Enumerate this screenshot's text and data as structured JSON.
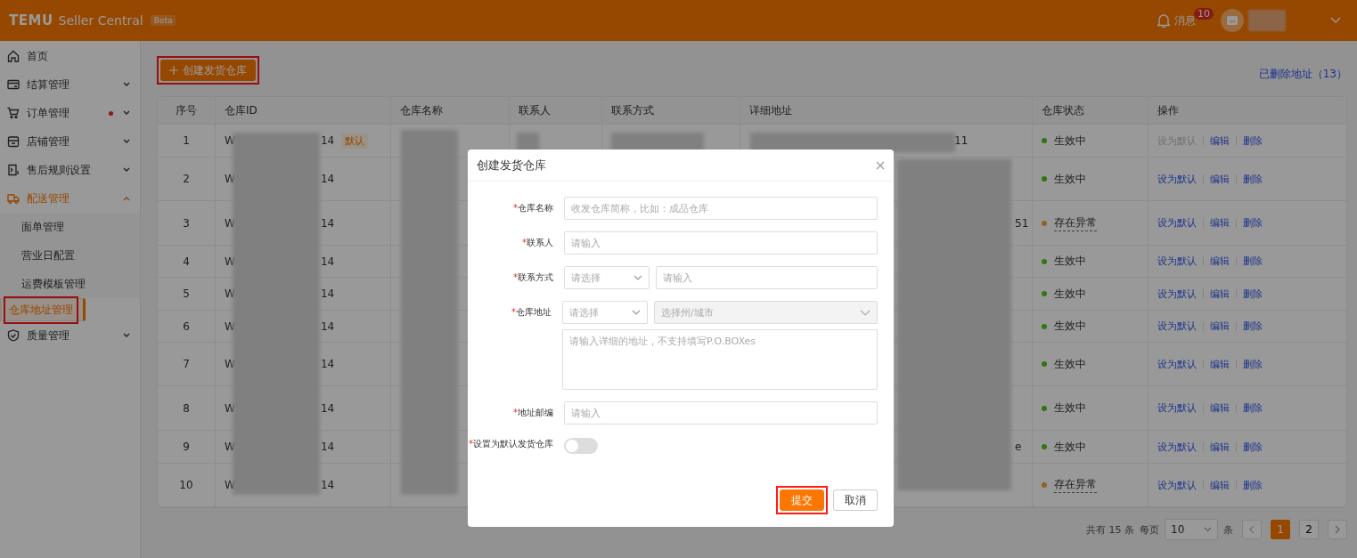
{
  "header": {
    "logo": "TEMU",
    "product": "Seller Central",
    "badge": "Beta",
    "messages": {
      "label": "消息",
      "count": "10"
    }
  },
  "sidebar": {
    "items": [
      {
        "label": "首页",
        "expandable": false,
        "expanded": false,
        "dot": false
      },
      {
        "label": "结算管理",
        "expandable": true,
        "expanded": false,
        "dot": false
      },
      {
        "label": "订单管理",
        "expandable": true,
        "expanded": false,
        "dot": true
      },
      {
        "label": "店铺管理",
        "expandable": true,
        "expanded": false,
        "dot": false
      },
      {
        "label": "售后规则设置",
        "expandable": true,
        "expanded": false,
        "dot": false
      },
      {
        "label": "配送管理",
        "expandable": true,
        "expanded": true,
        "dot": false,
        "children": [
          {
            "label": "面单管理",
            "selected": false,
            "annotated": false
          },
          {
            "label": "营业日配置",
            "selected": false,
            "annotated": false
          },
          {
            "label": "运费模板管理",
            "selected": false,
            "annotated": false
          },
          {
            "label": "仓库地址管理",
            "selected": true,
            "annotated": true
          }
        ]
      },
      {
        "label": "质量管理",
        "expandable": true,
        "expanded": false,
        "dot": false
      }
    ]
  },
  "toolbar": {
    "create_button": {
      "label": "创建发货仓库",
      "annotated": true
    },
    "deleted_link": "已删除地址（13）"
  },
  "table": {
    "columns": [
      "序号",
      "仓库ID",
      "仓库名称",
      "联系人",
      "联系方式",
      "详细地址",
      "仓库状态",
      "操作"
    ],
    "rows": [
      {
        "index": "1",
        "id_start": "W",
        "id_end": "14",
        "default_tag": "默认",
        "address_tail": "11",
        "status": {
          "label": "生效中",
          "kind": "normal"
        },
        "actions": [
          {
            "label": "设为默认",
            "disabled": true
          },
          {
            "label": "编辑",
            "disabled": false
          },
          {
            "label": "删除",
            "disabled": false
          }
        ]
      },
      {
        "index": "2",
        "id_start": "W",
        "id_end": "14",
        "status": {
          "label": "生效中",
          "kind": "normal"
        },
        "actions": [
          {
            "label": "设为默认",
            "disabled": false
          },
          {
            "label": "编辑",
            "disabled": false
          },
          {
            "label": "删除",
            "disabled": false
          }
        ]
      },
      {
        "index": "3",
        "id_start": "W",
        "id_end": "14",
        "address_tail": "51",
        "status": {
          "label": "存在异常",
          "kind": "warning"
        },
        "actions": [
          {
            "label": "设为默认",
            "disabled": false
          },
          {
            "label": "编辑",
            "disabled": false
          },
          {
            "label": "删除",
            "disabled": false
          }
        ]
      },
      {
        "index": "4",
        "id_start": "W",
        "id_end": "14",
        "status": {
          "label": "生效中",
          "kind": "normal"
        },
        "actions": [
          {
            "label": "设为默认",
            "disabled": false
          },
          {
            "label": "编辑",
            "disabled": false
          },
          {
            "label": "删除",
            "disabled": false
          }
        ]
      },
      {
        "index": "5",
        "id_start": "W",
        "id_end": "14",
        "status": {
          "label": "生效中",
          "kind": "normal"
        },
        "actions": [
          {
            "label": "设为默认",
            "disabled": false
          },
          {
            "label": "编辑",
            "disabled": false
          },
          {
            "label": "删除",
            "disabled": false
          }
        ]
      },
      {
        "index": "6",
        "id_start": "W",
        "id_end": "14",
        "status": {
          "label": "生效中",
          "kind": "normal"
        },
        "actions": [
          {
            "label": "设为默认",
            "disabled": false
          },
          {
            "label": "编辑",
            "disabled": false
          },
          {
            "label": "删除",
            "disabled": false
          }
        ]
      },
      {
        "index": "7",
        "id_start": "W",
        "id_end": "14",
        "status": {
          "label": "生效中",
          "kind": "normal"
        },
        "actions": [
          {
            "label": "设为默认",
            "disabled": false
          },
          {
            "label": "编辑",
            "disabled": false
          },
          {
            "label": "删除",
            "disabled": false
          }
        ]
      },
      {
        "index": "8",
        "id_start": "W",
        "id_end": "14",
        "status": {
          "label": "生效中",
          "kind": "normal"
        },
        "actions": [
          {
            "label": "设为默认",
            "disabled": false
          },
          {
            "label": "编辑",
            "disabled": false
          },
          {
            "label": "删除",
            "disabled": false
          }
        ]
      },
      {
        "index": "9",
        "id_start": "W",
        "id_end": "14",
        "address_tail": "e",
        "status": {
          "label": "生效中",
          "kind": "normal"
        },
        "actions": [
          {
            "label": "设为默认",
            "disabled": false
          },
          {
            "label": "编辑",
            "disabled": false
          },
          {
            "label": "删除",
            "disabled": false
          }
        ]
      },
      {
        "index": "10",
        "id_start": "W",
        "id_end": "14",
        "status": {
          "label": "存在异常",
          "kind": "warning"
        },
        "actions": [
          {
            "label": "设为默认",
            "disabled": false
          },
          {
            "label": "编辑",
            "disabled": false
          },
          {
            "label": "删除",
            "disabled": false
          }
        ]
      }
    ]
  },
  "pagination": {
    "total": "共有 15 条",
    "per_page_label": "每页",
    "per_page": "10",
    "unit": "条",
    "pages": [
      {
        "label": "1",
        "selected": true
      },
      {
        "label": "2",
        "selected": false
      }
    ]
  },
  "dialog": {
    "title": "创建发货仓库",
    "required_mark": "*",
    "fields": [
      {
        "kind": "input",
        "label": "仓库名称",
        "required": true,
        "placeholder": "收发仓库简称，比如：成品仓库"
      },
      {
        "kind": "input",
        "label": "联系人",
        "required": true,
        "placeholder": "请输入"
      },
      {
        "kind": "select-input",
        "label": "联系方式",
        "required": true,
        "select_placeholder": "请选择",
        "placeholder": "请输入"
      },
      {
        "kind": "address",
        "label": "仓库地址",
        "required": true,
        "select_placeholder": "请选择",
        "region_placeholder": "选择州/城市",
        "region_disabled": true,
        "detail_placeholder": "请输入详细的地址，不支持填写P.O.BOXes"
      },
      {
        "kind": "input",
        "label": "地址邮编",
        "required": true,
        "placeholder": "请输入"
      },
      {
        "kind": "switch",
        "label": "设置为默认发货仓库",
        "required": true,
        "on": false
      }
    ],
    "buttons": [
      {
        "label": "提交",
        "kind": "primary",
        "annotated": true
      },
      {
        "label": "取消",
        "kind": "default",
        "annotated": false
      }
    ]
  }
}
